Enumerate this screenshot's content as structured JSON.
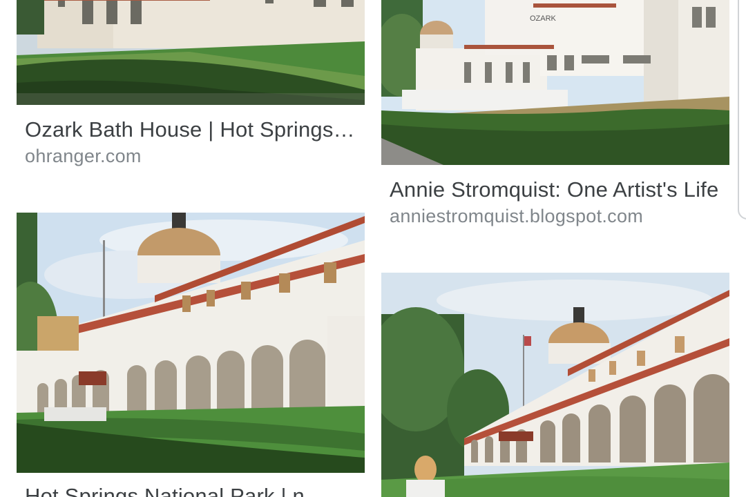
{
  "results": [
    {
      "title": "Ozark Bath House | Hot Springs National Park",
      "source": "ohranger.com",
      "image_icon": "bathhouse-photo"
    },
    {
      "title": "Annie Stromquist: One Artist's Life",
      "source": "anniestromquist.blogspot.com",
      "sign_text": "OZARK",
      "image_icon": "ozark-bathhouse-photo"
    },
    {
      "title": "Hot Springs National Park | n",
      "source": "",
      "image_icon": "quapaw-bathhouse-photo"
    },
    {
      "title": "",
      "source": "",
      "image_icon": "quapaw-arcade-photo"
    }
  ],
  "colors": {
    "title": "#3c4043",
    "source": "#80868b",
    "sky": "#cfe0ef",
    "building": "#eeeae2",
    "roof": "#b5503a",
    "dome": "#c69a64",
    "grass": "#3f7a34",
    "hedge": "#2f5424"
  }
}
